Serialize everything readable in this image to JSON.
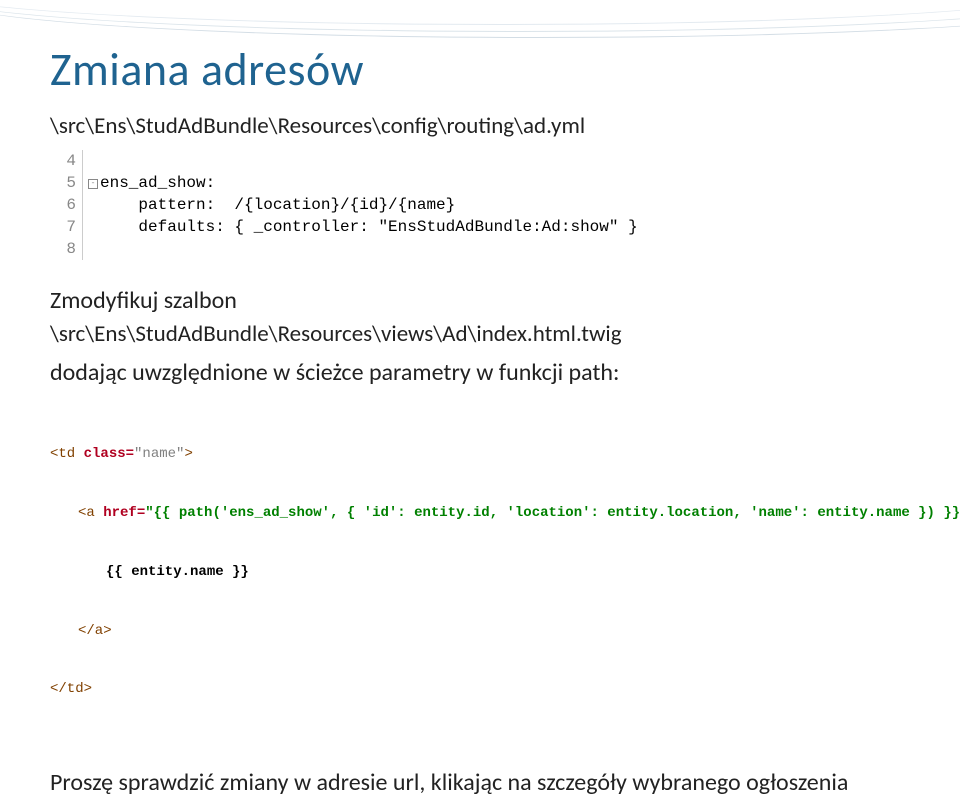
{
  "title": "Zmiana adresów",
  "path_line_1": "\\src\\Ens\\StudAdBundle\\Resources\\config\\routing\\ad.yml",
  "yaml_block": {
    "rows": [
      {
        "num": "4",
        "fold": "",
        "text": ""
      },
      {
        "num": "5",
        "fold": "-",
        "text": "ens_ad_show:"
      },
      {
        "num": "6",
        "fold": "",
        "text": "    pattern:  /{location}/{id}/{name}"
      },
      {
        "num": "7",
        "fold": "",
        "text": "    defaults: { _controller: \"EnsStudAdBundle:Ad:show\" }"
      },
      {
        "num": "8",
        "fold": "",
        "text": ""
      }
    ]
  },
  "modify_template_label": "Zmodyfikuj szalbon",
  "path_line_2": "\\src\\Ens\\StudAdBundle\\Resources\\views\\Ad\\index.html.twig",
  "adding_params_label": "dodając uwzględnione w ścieżce parametry w funkcji path:",
  "twig_block": {
    "l1_open_td": "<td",
    "l1_class_attr": " class=",
    "l1_class_val": "\"name\"",
    "l1_close": ">",
    "l2_open_a": "<a",
    "l2_href_attr": " href=",
    "l2_href_val": "\"{{ path('ens_ad_show', { 'id': entity.id, 'location': entity.location, 'name': entity.name }) }}\"",
    "l2_close": ">",
    "l3_text": "{{ entity.name }}",
    "l4": "</a>",
    "l5": "</td>"
  },
  "bottom_note": "Proszę sprawdzić zmiany w adresie url, klikając na szczegóły wybranego ogłoszenia"
}
